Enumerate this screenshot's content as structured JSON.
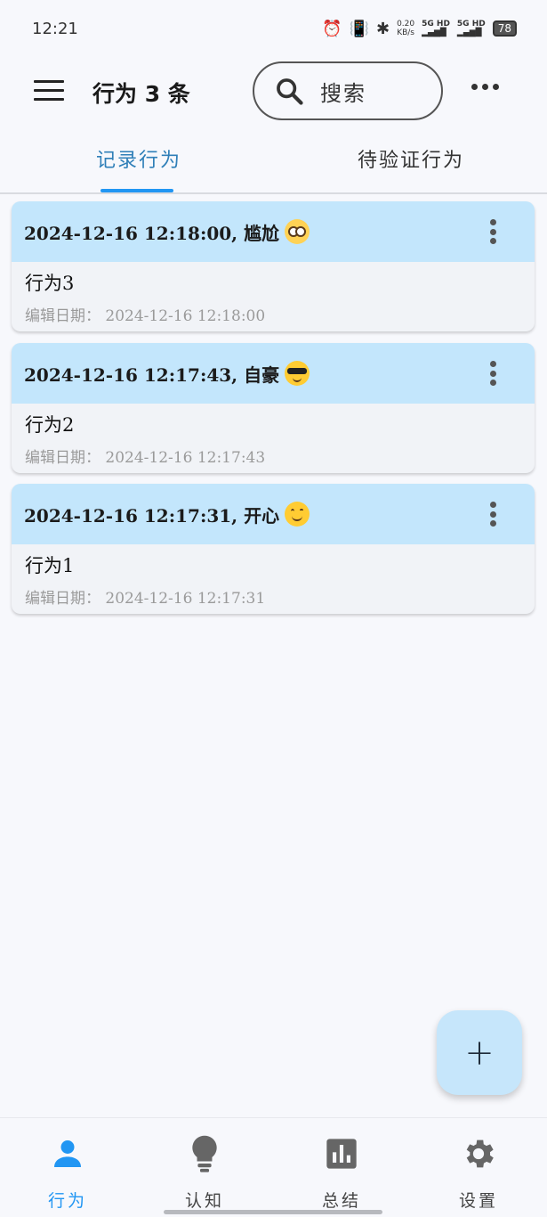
{
  "status_bar": {
    "time": "12:21",
    "net_speed_value": "0.20",
    "net_speed_unit": "KB/s",
    "signal1": "5G HD",
    "signal2": "5G HD",
    "battery": "78"
  },
  "app_bar": {
    "title": "行为 3 条",
    "search_label": "搜索"
  },
  "tabs": [
    {
      "label": "记录行为",
      "active": true
    },
    {
      "label": "待验证行为",
      "active": false
    }
  ],
  "records": [
    {
      "header": "2024-12-16 12:18:00, 尴尬",
      "emoji": "flushed-face-icon",
      "text": "行为3",
      "date": "编辑日期： 2024-12-16 12:18:00"
    },
    {
      "header": "2024-12-16 12:17:43, 自豪",
      "emoji": "sunglasses-face-icon",
      "text": "行为2",
      "date": "编辑日期： 2024-12-16 12:17:43"
    },
    {
      "header": "2024-12-16 12:17:31, 开心",
      "emoji": "smiling-face-icon",
      "text": "行为1",
      "date": "编辑日期： 2024-12-16 12:17:31"
    }
  ],
  "fab": {
    "label": "+"
  },
  "bottom_nav": [
    {
      "label": "行为",
      "icon": "person-icon",
      "active": true
    },
    {
      "label": "认知",
      "icon": "lightbulb-icon",
      "active": false
    },
    {
      "label": "总结",
      "icon": "bar-chart-icon",
      "active": false
    },
    {
      "label": "设置",
      "icon": "gear-icon",
      "active": false
    }
  ],
  "colors": {
    "accent": "#2196f3",
    "card_header": "#c3e6fc",
    "fab": "#c6e6fb",
    "background": "#f7f8fc"
  }
}
